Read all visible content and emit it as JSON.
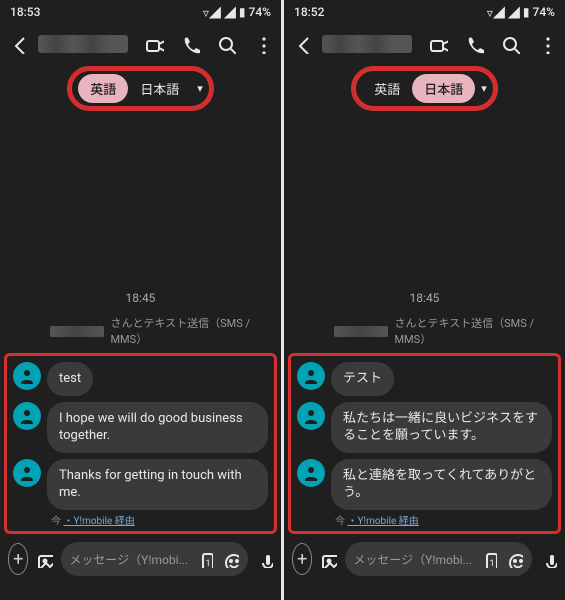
{
  "left": {
    "status_time": "18:53",
    "battery": "74%",
    "lang": {
      "opt1": "英語",
      "opt2": "日本語",
      "active": 1
    },
    "timestamp": "18:45",
    "sys_label_suffix": "さんとテキスト送信（SMS / MMS）",
    "messages": [
      {
        "text": "test"
      },
      {
        "text": "I hope we will do good business together."
      },
      {
        "text": "Thanks for getting in touch with me."
      }
    ],
    "meta_now": "今",
    "meta_via": "・Y!mobile 経由",
    "composer_placeholder": "メッセージ（Y!mobi..."
  },
  "right": {
    "status_time": "18:52",
    "battery": "74%",
    "lang": {
      "opt1": "英語",
      "opt2": "日本語",
      "active": 2
    },
    "timestamp": "18:45",
    "sys_label_suffix": "さんとテキスト送信（SMS / MMS）",
    "messages": [
      {
        "text": "テスト"
      },
      {
        "text": "私たちは一緒に良いビジネスをすることを願っています。"
      },
      {
        "text": "私と連絡を取ってくれてありがとう。"
      }
    ],
    "meta_now": "今",
    "meta_via": "・Y!mobile 経由",
    "composer_placeholder": "メッセージ（Y!mobi..."
  }
}
